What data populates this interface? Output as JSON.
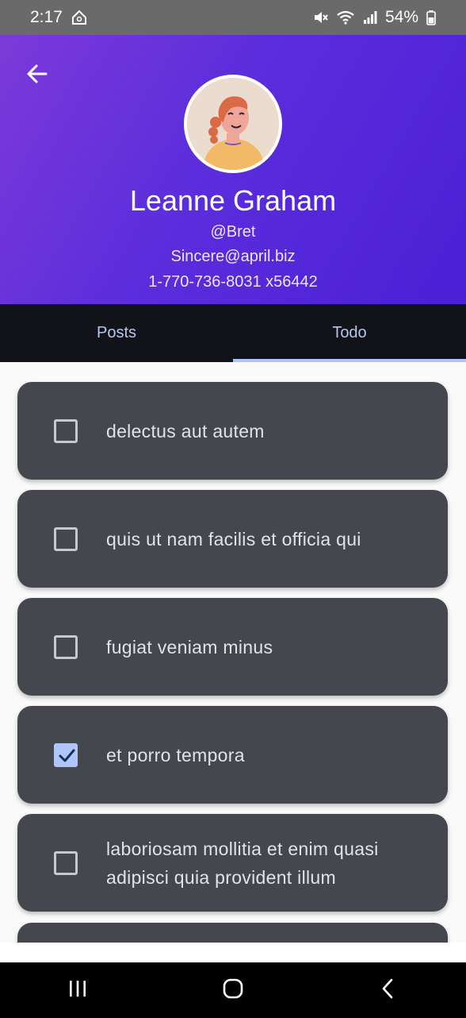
{
  "status_bar": {
    "time": "2:17",
    "battery": "54%"
  },
  "profile": {
    "name": "Leanne Graham",
    "handle": "@Bret",
    "email": "Sincere@april.biz",
    "phone": "1-770-736-8031 x56442"
  },
  "tabs": [
    {
      "label": "Posts",
      "active": false
    },
    {
      "label": "Todo",
      "active": true
    }
  ],
  "todos": [
    {
      "title": "delectus aut autem",
      "completed": false
    },
    {
      "title": "quis ut nam facilis et officia qui",
      "completed": false
    },
    {
      "title": "fugiat veniam minus",
      "completed": false
    },
    {
      "title": "et porro tempora",
      "completed": true
    },
    {
      "title": "laboriosam mollitia et enim quasi adipisci quia provident illum",
      "completed": false
    }
  ],
  "colors": {
    "header_gradient_start": "#7c3ad9",
    "header_gradient_end": "#4b1fd6",
    "tab_bar": "#111318",
    "tab_indicator": "#aec4f6",
    "card": "#45474e",
    "checkbox_checked": "#afc6f8"
  },
  "icons": {
    "back": "arrow-left-icon",
    "home": "home-icon",
    "mute": "mute-icon",
    "wifi": "wifi-icon",
    "signal": "signal-icon",
    "battery": "battery-icon",
    "checkmark": "check-icon",
    "nav_recents": "recents-icon",
    "nav_home": "nav-home-icon",
    "nav_back": "nav-back-icon"
  }
}
